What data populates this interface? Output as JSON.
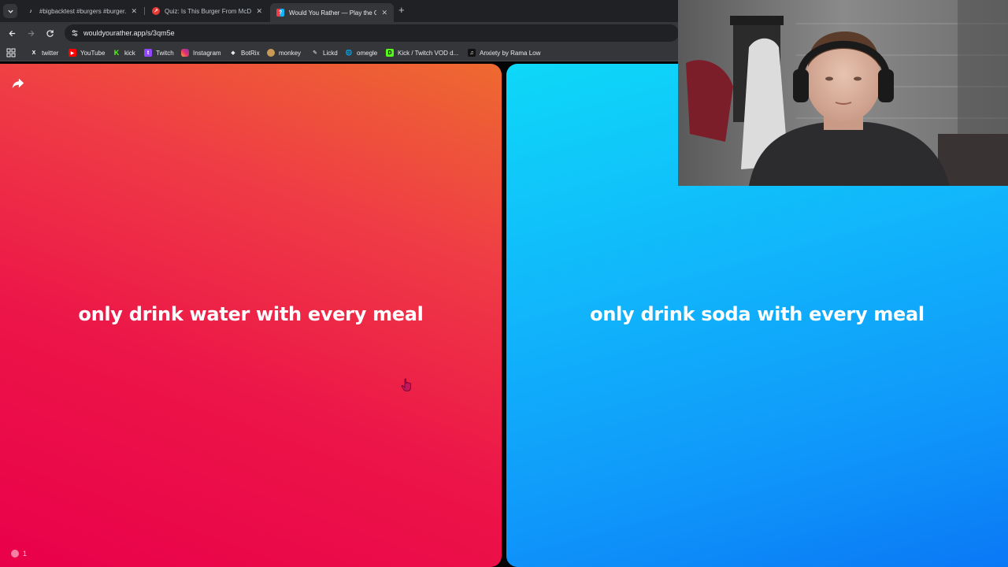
{
  "browser": {
    "tabs": [
      {
        "title": "#bigbacktest #burgers #burger...",
        "favicon": "tiktok-icon",
        "active": false
      },
      {
        "title": "Quiz: Is This Burger From McDo...",
        "favicon": "quiz-icon",
        "active": false
      },
      {
        "title": "Would You Rather — Play the G...",
        "favicon": "wyr-icon",
        "active": true
      }
    ],
    "url": "wouldyourather.app/s/3qm5e",
    "bookmarks": [
      {
        "label": "twitter",
        "icon": "x-icon"
      },
      {
        "label": "YouTube",
        "icon": "youtube-icon"
      },
      {
        "label": "kick",
        "icon": "kick-icon"
      },
      {
        "label": "Twitch",
        "icon": "twitch-icon"
      },
      {
        "label": "Instagram",
        "icon": "instagram-icon"
      },
      {
        "label": "BotRix",
        "icon": "botrix-icon"
      },
      {
        "label": "monkey",
        "icon": "monkey-icon"
      },
      {
        "label": "Lickd",
        "icon": "lickd-icon"
      },
      {
        "label": "omegle",
        "icon": "omegle-icon"
      },
      {
        "label": "Kick / Twitch VOD d...",
        "icon": "d-icon"
      },
      {
        "label": "Anxiety by Rama Low",
        "icon": "music-icon"
      }
    ]
  },
  "game": {
    "option_a": {
      "text": "only drink water with every meal",
      "color": "#ec1548"
    },
    "option_b": {
      "text": "only drink soda with every meal",
      "color": "#0f96fa"
    },
    "likes": "1"
  }
}
